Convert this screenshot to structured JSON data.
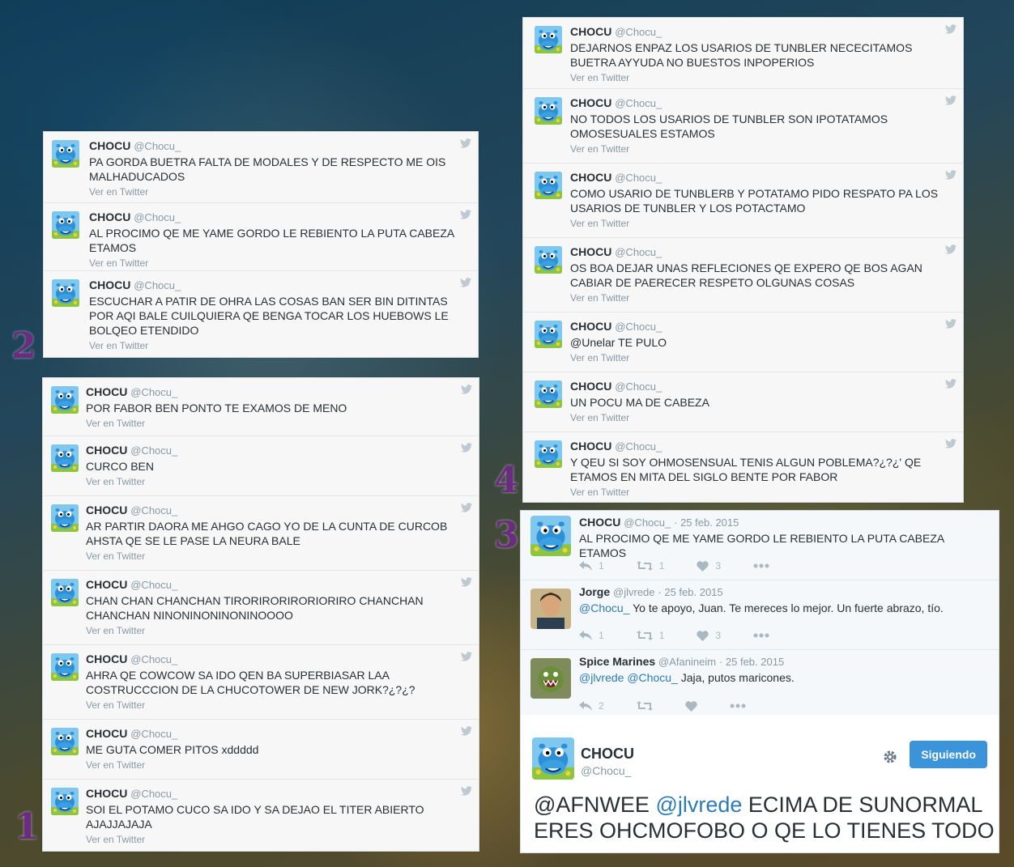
{
  "panel2": [
    {
      "name": "CHOCU",
      "handle": "@Chocu_",
      "text": "PA GORDA BUETRA FALTA DE MODALES Y DE RESPECTO ME OIS MALHADUCADOS",
      "link": "Ver en Twitter"
    },
    {
      "name": "CHOCU",
      "handle": "@Chocu_",
      "text": "AL PROCIMO QE ME YAME GORDO LE REBIENTO LA PUTA CABEZA ETAMOS",
      "link": "Ver en Twitter"
    },
    {
      "name": "CHOCU",
      "handle": "@Chocu_",
      "text": "ESCUCHAR A PATIR DE OHRA LAS COSAS BAN SER BIN DITINTAS POR AQI BALE CUILQUIERA QE BENGA TOCAR LOS HUEBOWS LE BOLQEO ETENDIDO",
      "link": "Ver en Twitter"
    }
  ],
  "panel1": [
    {
      "name": "CHOCU",
      "handle": "@Chocu_",
      "text": "POR FABOR BEN PONTO TE EXAMOS DE MENO",
      "link": "Ver en Twitter"
    },
    {
      "name": "CHOCU",
      "handle": "@Chocu_",
      "text": "CURCO BEN",
      "link": "Ver en Twitter"
    },
    {
      "name": "CHOCU",
      "handle": "@Chocu_",
      "text": "AR PARTIR DAORA ME AHGO CAGO YO DE LA CUNTA DE CURCOB AHSTA QE SE LE PASE LA NEURA BALE",
      "link": "Ver en Twitter"
    },
    {
      "name": "CHOCU",
      "handle": "@Chocu_",
      "text": "CHAN CHAN CHANCHAN TIRORIRORIRORIORIRO CHANCHAN CHANCHAN NINONINONINONINOOOO",
      "link": "Ver en Twitter"
    },
    {
      "name": "CHOCU",
      "handle": "@Chocu_",
      "text": "AHRA QE COWCOW SA IDO QEN BA SUPERBIASAR LAA COSTRUCCCION DE LA CHUCOTOWER DE NEW JORK?¿?¿?",
      "link": "Ver en Twitter"
    },
    {
      "name": "CHOCU",
      "handle": "@Chocu_",
      "text": "ME GUTA COMER PITOS xddddd",
      "link": "Ver en Twitter"
    },
    {
      "name": "CHOCU",
      "handle": "@Chocu_",
      "text": "SOI EL POTAMO CUCO SA IDO Y SA DEJAO EL TITER ABIERTO AJAJJAJAJA",
      "link": "Ver en Twitter"
    }
  ],
  "panel4": [
    {
      "name": "CHOCU",
      "handle": "@Chocu_",
      "text": "DEJARNOS ENPAZ LOS USARIOS DE TUNBLER NECECITAMOS BUETRA AYYUDA NO BUESTOS INPOPERIOS",
      "link": "Ver en Twitter"
    },
    {
      "name": "CHOCU",
      "handle": "@Chocu_",
      "text": "NO TODOS LOS USARIOS DE TUNBLER SON IPOTATAMOS OMOSESUALES ESTAMOS",
      "link": "Ver en Twitter"
    },
    {
      "name": "CHOCU",
      "handle": "@Chocu_",
      "text": "COMO USARIO DE TUNBLERB Y POTATAMO PIDO RESPATO PA LOS USARIOS DE TUNBLER Y LOS POTACTAMO",
      "link": "Ver en Twitter"
    },
    {
      "name": "CHOCU",
      "handle": "@Chocu_",
      "text": "OS BOA DEJAR UNAS REFLECIONES QE EXPERO QE BOS AGAN CABIAR DE PAERECER RESPETO OLGUNAS COSAS",
      "link": "Ver en Twitter"
    },
    {
      "name": "CHOCU",
      "handle": "@Chocu_",
      "text": "@Unelar TE PULO",
      "link": "Ver en Twitter"
    },
    {
      "name": "CHOCU",
      "handle": "@Chocu_",
      "text": "UN POCU MA DE CABEZA",
      "link": "Ver en Twitter"
    },
    {
      "name": "CHOCU",
      "handle": "@Chocu_",
      "text": "Y QEU SI SOY OHMOSENSUAL TENIS ALGUN POBLEMA?¿?¿' QE ETAMOS EN MITA DEL SIGLO BENTE POR FABOR",
      "link": "Ver en Twitter"
    }
  ],
  "numbers": {
    "n1": "1",
    "n2": "2",
    "n3": "3",
    "n4": "4"
  },
  "conversation": {
    "t1": {
      "name": "CHOCU",
      "handle": "@Chocu_",
      "date": "· 25 feb. 2015",
      "text": "AL PROCIMO QE ME YAME GORDO LE REBIENTO LA PUTA CABEZA ETAMOS",
      "reply": "1",
      "retweet": "1",
      "fav": "3"
    },
    "t2": {
      "name": "Jorge",
      "handle": "@jlvrede",
      "date": "· 25 feb. 2015",
      "mention": "@Chocu_",
      "text": " Yo te apoyo, Juan. Te mereces lo mejor. Un fuerte abrazo, tío.",
      "reply": "1",
      "retweet": "1",
      "fav": "3"
    },
    "t3": {
      "name": "Spice Marines",
      "handle": "@Afanineim",
      "date": "· 25 feb. 2015",
      "mention1": "@jlvrede",
      "mention2": "@Chocu_",
      "text": " Jaja, putos maricones.",
      "reply": "2"
    },
    "main": {
      "name": "CHOCU",
      "handle": "@Chocu_",
      "follow": "Siguiendo",
      "line1_a": "@AFNWEE",
      "line1_b": "@jlvrede",
      "line1_c": " ECIMA DE SUNORMAL",
      "line2": "ERES OHCMOFOBO O QE LO TIENES TODO"
    }
  }
}
